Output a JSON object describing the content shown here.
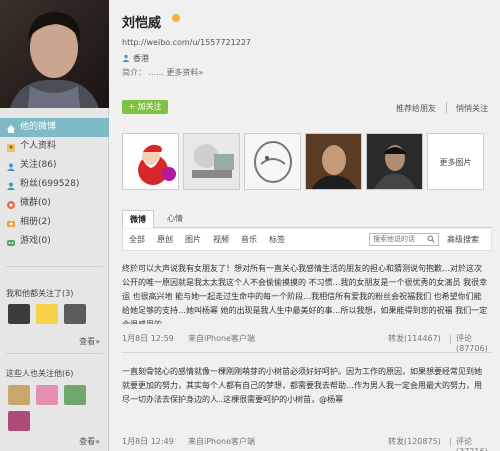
{
  "profile": {
    "name": "刘恺威",
    "url": "http://weibo.com/u/1557721227",
    "location": "香港",
    "bio_label": "简介：",
    "bio_text": "......",
    "bio_more": "更多资料»"
  },
  "actions": {
    "follow": "+ 加关注",
    "recommend": "推荐给朋友",
    "mutual": "悄悄关注"
  },
  "sidebar": {
    "nav": [
      {
        "label": "他的微博",
        "icon": "home-icon"
      },
      {
        "label": "个人资料",
        "icon": "profile-icon"
      },
      {
        "label": "关注(86)",
        "icon": "follow-icon"
      },
      {
        "label": "粉丝(699528)",
        "icon": "fans-icon"
      },
      {
        "label": "微群(0)",
        "icon": "group-icon"
      },
      {
        "label": "相册(2)",
        "icon": "album-icon"
      },
      {
        "label": "游戏(0)",
        "icon": "game-icon"
      }
    ],
    "common_follow_title": "我和他都关注了(3)",
    "common_more": "查看»",
    "also_follow_title": "这些人也关注他(6)",
    "also_more": "查看»"
  },
  "photos": {
    "more": "更多图片",
    "items": [
      "photo-santa",
      "photo-modern",
      "photo-ice",
      "photo-man-1",
      "photo-man-2"
    ]
  },
  "tabs": [
    "微博",
    "心情"
  ],
  "filters": [
    "全部",
    "原创",
    "图片",
    "视频",
    "音乐",
    "标签"
  ],
  "search": {
    "placeholder": "搜索他说的话",
    "advanced": "高级搜索"
  },
  "posts": [
    {
      "text": "终於可以大声说我有女朋友了！想对所有一直关心我感情生活的朋友的担心和猜测说句抱歉…对於这次公开的唯一原因就是我太太我这个人不会偷偷摸摸的 不习惯…我的女朋友是一个很优秀的女演员 我很幸运 也很高兴地 能与她一起走过生命中的每一个阶段…我相信所有爱我的粉丝会祝福我们 也希望你们能给她足够的支持…她叫杨幂 她的出现是我人生中最美好的事…所以我想，如果能得到您的祝福 我们一定会很感恩的",
      "time": "1月8日 12:59",
      "from": "来自iPhone客户端",
      "repost": "转发(114467)",
      "comment": "评论(87706)"
    },
    {
      "text": "一直刻骨铭心的感情就像一棵刚刚萌芽的小树苗必须好好呵护。因为工作的原因，如果想要经常见到她就要更加的努力，其实每个人都有自己的梦想，都需要我去帮助…作为男人我一定会用最大的努力，用尽一切办法去保护身边的人..这棵很需要呵护的小树苗，@杨幂",
      "time": "1月8日 12:49",
      "from": "来自iPhone客户端",
      "repost": "转发(120875)",
      "comment": "评论(37216)"
    }
  ],
  "colors": {
    "sidebar_active": "#7fb9c5",
    "follow_green": "#7dc241",
    "vip_badge": "#f3b33a"
  }
}
